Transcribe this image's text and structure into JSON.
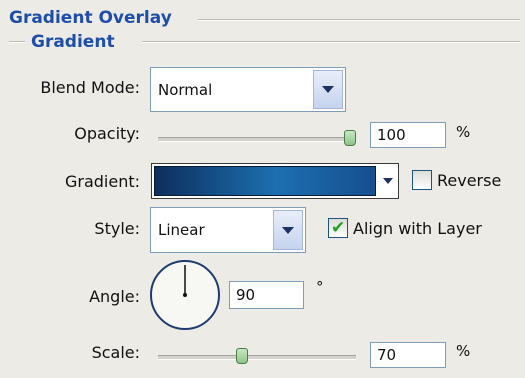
{
  "panel": {
    "section_title": "Gradient Overlay",
    "subsection_title": "Gradient"
  },
  "blend_mode": {
    "label": "Blend Mode:",
    "value": "Normal"
  },
  "opacity": {
    "label": "Opacity:",
    "value": "100",
    "unit": "%",
    "level": 1.0
  },
  "gradient": {
    "label": "Gradient:",
    "colors": [
      "#0d2f5e",
      "#1c6fb0",
      "#154f90"
    ],
    "reverse_label": "Reverse",
    "reverse_checked": false
  },
  "style": {
    "label": "Style:",
    "value": "Linear",
    "align_label": "Align with Layer",
    "align_checked": true
  },
  "angle": {
    "label": "Angle:",
    "value": "90",
    "unit": "°",
    "degrees": 90
  },
  "scale": {
    "label": "Scale:",
    "value": "70",
    "unit": "%",
    "level": 0.42
  }
}
